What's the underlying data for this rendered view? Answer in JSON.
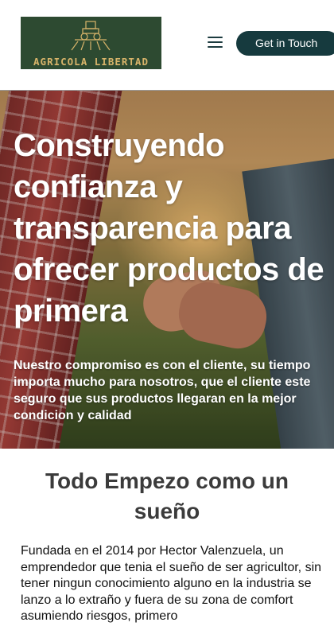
{
  "header": {
    "logo_text": "AGRICOLA LIBERTAD",
    "logo_icon": "tractor-icon",
    "menu_icon": "hamburger-menu-icon",
    "cta_label": "Get in Touch"
  },
  "hero": {
    "title": "Construyendo confianza y transparencia para ofrecer productos de primera",
    "subtitle": "Nuestro compromiso es con el cliente, su tiempo importa mucho para nosotros, que el cliente este seguro que sus productos llegaran en la mejor condicion y calidad"
  },
  "about": {
    "title": "Todo Empezo como un sueño",
    "body": "Fundada en el 2014 por Hector Valenzuela, un emprendedor que tenia el sueño de ser agricultor, sin tener ningun conocimiento alguno en la industria se lanzo a lo extraño y fuera de su zona de comfort asumiendo riesgos, primero"
  },
  "colors": {
    "brand_dark": "#163a3e",
    "logo_bg": "#2d4a31",
    "logo_gold": "#d8b46a"
  }
}
